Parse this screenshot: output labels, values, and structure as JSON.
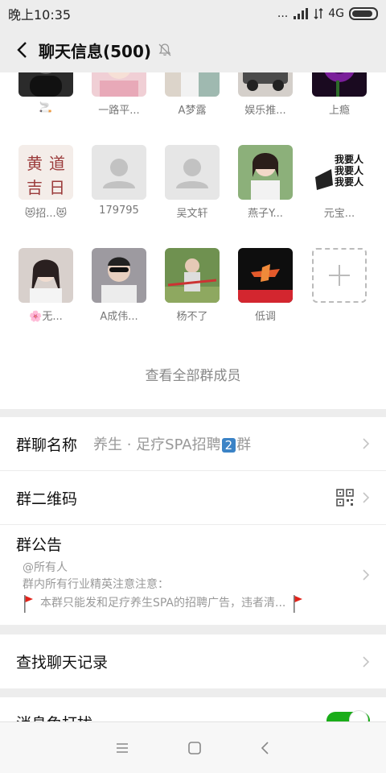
{
  "status": {
    "time": "晚上10:35",
    "net": "4G",
    "dots": "..."
  },
  "header": {
    "title": "聊天信息(500)"
  },
  "members": [
    {
      "name": "🚬",
      "avatar_color": "#2a2a2a"
    },
    {
      "name": "一路平...",
      "avatar_color": "#e9c2c9"
    },
    {
      "name": "A梦露",
      "avatar_color": "#d9cdbf"
    },
    {
      "name": "娱乐推...",
      "avatar_color": "#5f5b58"
    },
    {
      "name": "上瘾",
      "avatar_color": "#5a1a6a"
    },
    {
      "name": "😻招...😻",
      "avatar_color": "#f4ede9",
      "avatar_text": "黄 道 吉 日"
    },
    {
      "name": "179795",
      "avatar_color": "#e6e6e6",
      "placeholder": true
    },
    {
      "name": "吴文轩",
      "avatar_color": "#e6e6e6",
      "placeholder": true
    },
    {
      "name": "燕子Y...",
      "avatar_color": "#7fa36d"
    },
    {
      "name": "元宝...",
      "avatar_color": "#ffffff",
      "avatar_text": "我要人"
    },
    {
      "name": "🌸无...",
      "avatar_color": "#cfc7c4"
    },
    {
      "name": "A成伟...",
      "avatar_color": "#7f7c80"
    },
    {
      "name": "杨不了",
      "avatar_color": "#6b8b4b"
    },
    {
      "name": "低调",
      "avatar_color": "#111111"
    }
  ],
  "view_all": "查看全部群成员",
  "group_name": {
    "label": "群聊名称",
    "value_prefix": "养生 · 足疗SPA招聘",
    "value_badge": "2",
    "value_suffix": "群"
  },
  "qr": {
    "label": "群二维码"
  },
  "notice": {
    "label": "群公告",
    "line1": "@所有人",
    "line2": "群内所有行业精英注意注意：",
    "line3": "本群只能发和足疗养生SPA的招聘广告，违者清..."
  },
  "search_history": {
    "label": "查找聊天记录"
  },
  "mute": {
    "label": "消息免打扰",
    "enabled": true
  },
  "colors": {
    "accent_green": "#1aad19",
    "badge_blue": "#3b83c6"
  }
}
